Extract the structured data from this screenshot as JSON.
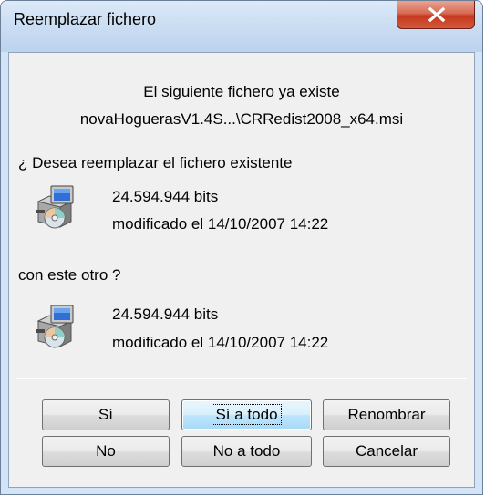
{
  "window": {
    "title": "Reemplazar fichero",
    "close_icon": "close-icon"
  },
  "message": {
    "line1": "El siguiente fichero ya existe",
    "line2": "novaHoguerasV1.4S...\\CRRedist2008_x64.msi",
    "question": "¿ Desea reemplazar el fichero existente",
    "with_other": "con este otro ?"
  },
  "existing_file": {
    "size": "24.594.944 bits",
    "modified": "modificado el 14/10/2007 14:22",
    "icon": "installer-package-icon"
  },
  "new_file": {
    "size": "24.594.944 bits",
    "modified": "modificado el 14/10/2007 14:22",
    "icon": "installer-package-icon"
  },
  "buttons": {
    "yes": "Sí",
    "yes_all": "Sí a todo",
    "rename": "Renombrar",
    "no": "No",
    "no_all": "No a todo",
    "cancel": "Cancelar"
  }
}
